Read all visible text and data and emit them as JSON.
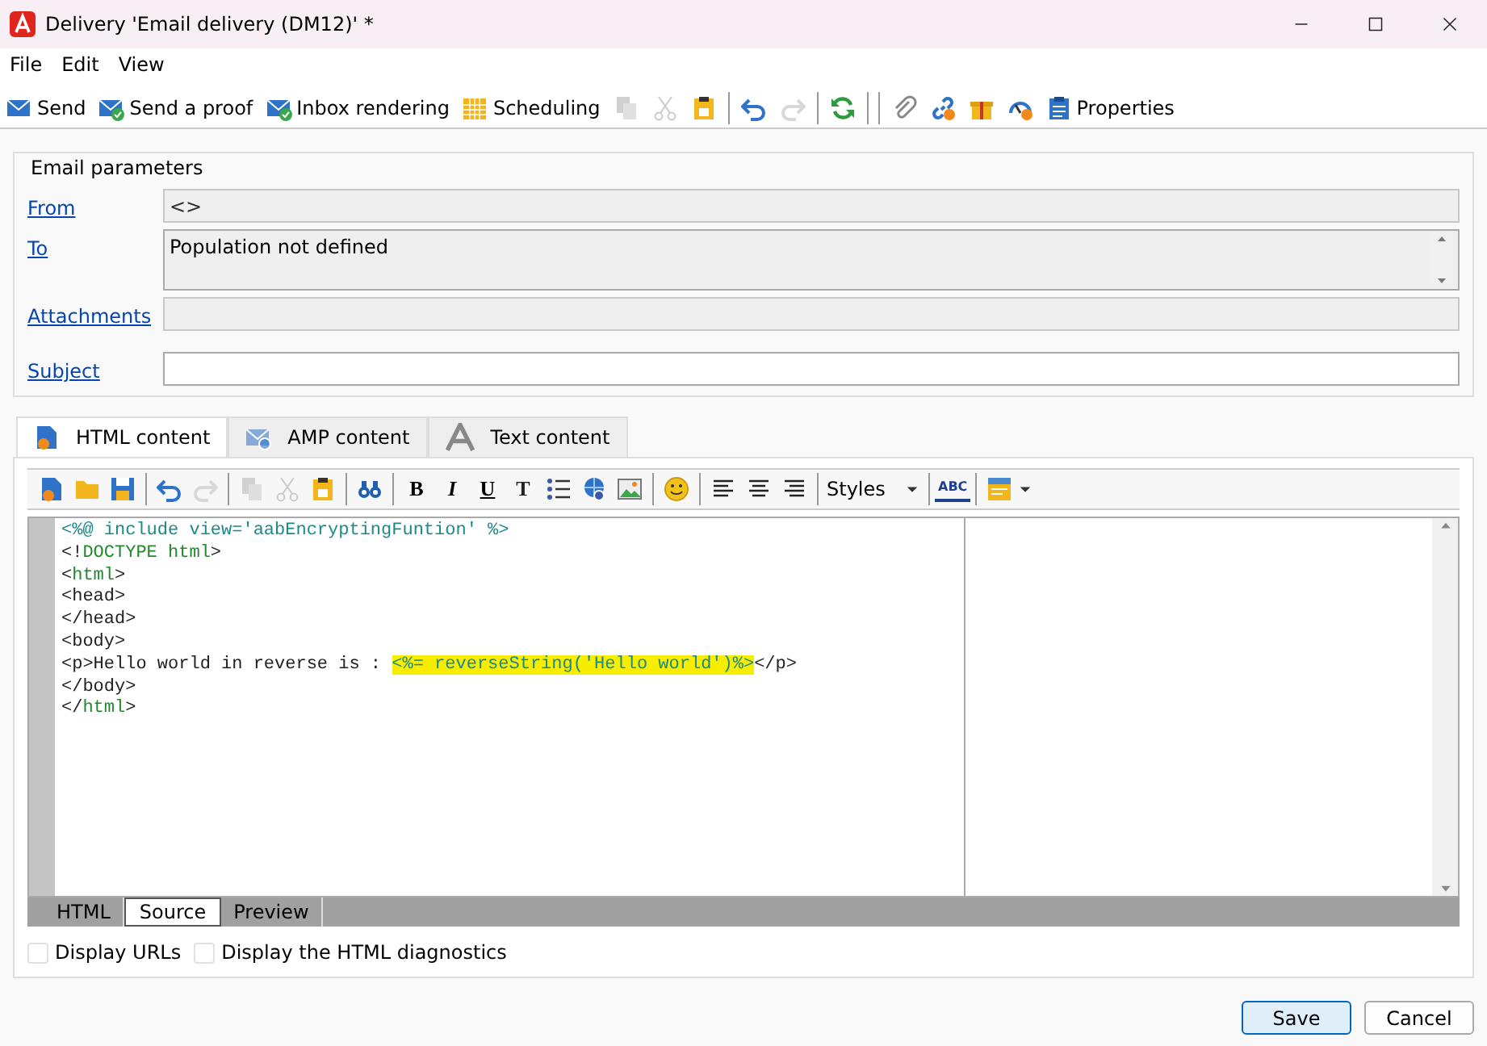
{
  "window": {
    "title": "Delivery 'Email delivery (DM12)' *"
  },
  "menu": [
    {
      "label": "File"
    },
    {
      "label": "Edit"
    },
    {
      "label": "View"
    }
  ],
  "toolbar": [
    {
      "kind": "button",
      "label": "Send",
      "disabled": false
    },
    {
      "kind": "button",
      "label": "Send a proof",
      "disabled": false
    },
    {
      "kind": "button",
      "label": "Inbox rendering",
      "disabled": false
    },
    {
      "kind": "button",
      "label": "Scheduling",
      "disabled": false
    },
    {
      "kind": "button",
      "disabled": true
    },
    {
      "kind": "button",
      "disabled": true
    },
    {
      "kind": "button",
      "disabled": false
    },
    {
      "kind": "separator"
    },
    {
      "kind": "button",
      "disabled": false
    },
    {
      "kind": "button",
      "disabled": true
    },
    {
      "kind": "separator"
    },
    {
      "kind": "button",
      "disabled": false
    },
    {
      "kind": "separator"
    },
    {
      "kind": "separator"
    },
    {
      "kind": "button",
      "disabled": false
    },
    {
      "kind": "button",
      "disabled": false
    },
    {
      "kind": "button",
      "disabled": false
    },
    {
      "kind": "button",
      "disabled": false
    },
    {
      "kind": "button",
      "label": "Properties",
      "disabled": false
    }
  ],
  "email_parameters": {
    "title": "Email parameters",
    "fields": [
      {
        "label": "From",
        "value": "<>",
        "readonly": true,
        "kind": "line"
      },
      {
        "label": "To",
        "value": "Population not defined",
        "readonly": true,
        "kind": "area"
      },
      {
        "label": "Attachments",
        "readonly": true,
        "kind": "line"
      },
      {
        "label": "Subject",
        "readonly": false,
        "kind": "line"
      }
    ]
  },
  "content_tabs": [
    {
      "label": "HTML content",
      "selected": true
    },
    {
      "label": "AMP content",
      "selected": false
    },
    {
      "label": "Text content",
      "selected": false
    }
  ],
  "editor_toolbar": [
    {
      "kind": "icon",
      "disabled": false
    },
    {
      "kind": "icon",
      "disabled": false
    },
    {
      "kind": "icon",
      "disabled": false
    },
    {
      "kind": "separator"
    },
    {
      "kind": "icon",
      "disabled": false
    },
    {
      "kind": "icon",
      "disabled": true
    },
    {
      "kind": "separator"
    },
    {
      "kind": "icon",
      "disabled": true
    },
    {
      "kind": "icon",
      "disabled": true
    },
    {
      "kind": "icon",
      "disabled": false
    },
    {
      "kind": "separator"
    },
    {
      "kind": "icon",
      "disabled": false
    },
    {
      "kind": "separator"
    },
    {
      "kind": "letter",
      "label": "B",
      "disabled": false
    },
    {
      "kind": "letter",
      "label": "I",
      "disabled": false
    },
    {
      "kind": "letter",
      "label": "U",
      "disabled": false
    },
    {
      "kind": "letter",
      "label": "T",
      "disabled": false
    },
    {
      "kind": "icon",
      "disabled": false
    },
    {
      "kind": "icon",
      "disabled": false
    },
    {
      "kind": "icon",
      "disabled": false
    },
    {
      "kind": "separator"
    },
    {
      "kind": "icon",
      "disabled": false
    },
    {
      "kind": "separator"
    },
    {
      "kind": "icon",
      "disabled": false
    },
    {
      "kind": "icon",
      "disabled": false
    },
    {
      "kind": "icon",
      "disabled": false
    },
    {
      "kind": "separator"
    },
    {
      "kind": "dropdown",
      "label": "Styles"
    },
    {
      "kind": "separator"
    },
    {
      "kind": "letter",
      "label": "ABC",
      "disabled": false
    },
    {
      "kind": "separator"
    },
    {
      "kind": "icon",
      "disabled": false
    }
  ],
  "source_lines": [
    [
      {
        "text": "<%@ include view='aabEncryptingFuntion' %>",
        "kind": "directive",
        "highlighted": false
      }
    ],
    [
      {
        "text": "<!",
        "kind": "punct",
        "highlighted": false
      },
      {
        "text": "DOCTYPE html",
        "kind": "tag",
        "highlighted": false
      },
      {
        "text": ">",
        "kind": "punct",
        "highlighted": false
      }
    ],
    [
      {
        "text": "<",
        "kind": "punct",
        "highlighted": false
      },
      {
        "text": "html",
        "kind": "tag",
        "highlighted": false
      },
      {
        "text": ">",
        "kind": "punct",
        "highlighted": false
      }
    ],
    [
      {
        "text": "<head>",
        "kind": "punct",
        "highlighted": false
      }
    ],
    [
      {
        "text": "</head>",
        "kind": "punct",
        "highlighted": false
      }
    ],
    [
      {
        "text": "<body>",
        "kind": "punct",
        "highlighted": false
      }
    ],
    [
      {
        "text": "<p>Hello world in reverse is : ",
        "kind": "punct",
        "highlighted": false
      },
      {
        "text": "<%= reverseString('Hello world')%>",
        "kind": "directive",
        "highlighted": true
      },
      {
        "text": "</p>",
        "kind": "punct",
        "highlighted": false
      }
    ],
    [
      {
        "text": "</body>",
        "kind": "punct",
        "highlighted": false
      }
    ],
    [
      {
        "text": "</",
        "kind": "punct",
        "highlighted": false
      },
      {
        "text": "html",
        "kind": "tag",
        "highlighted": false
      },
      {
        "text": ">",
        "kind": "punct",
        "highlighted": false
      }
    ]
  ],
  "view_tabs": [
    {
      "label": "HTML",
      "selected": false
    },
    {
      "label": "Source",
      "selected": true
    },
    {
      "label": "Preview",
      "selected": false
    }
  ],
  "options": [
    {
      "label": "Display URLs",
      "checked": false
    },
    {
      "label": "Display the HTML diagnostics",
      "checked": false
    }
  ],
  "buttons": [
    {
      "label": "Save",
      "default": true
    },
    {
      "label": "Cancel",
      "default": false
    }
  ]
}
